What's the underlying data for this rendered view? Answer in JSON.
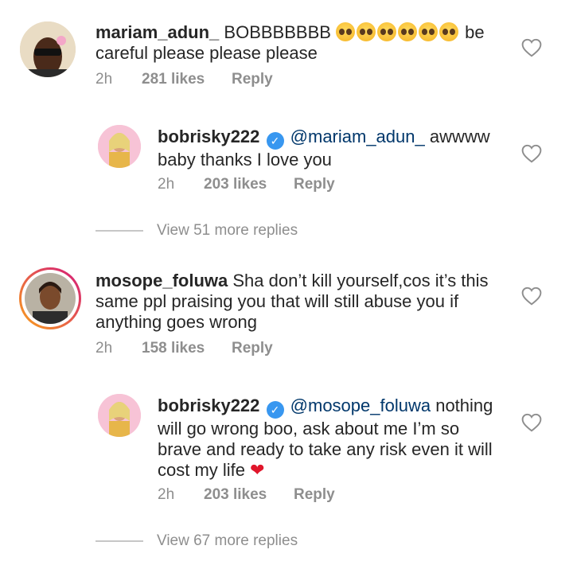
{
  "comments": [
    {
      "username": "mariam_adun_",
      "text_line1_after_user": " BOBBBBBBB ",
      "emoji_count": 6,
      "emoji_name": "pleading-face",
      "text_line1_tail": " be",
      "text_line2": "careful please please please",
      "time": "2h",
      "likes": "281 likes",
      "reply": "Reply"
    },
    {
      "username": "bobrisky222",
      "mention": "@mariam_adun_",
      "text_line1_tail": " awwww",
      "text_line2": "baby thanks I love you",
      "time": "2h",
      "likes": "203 likes",
      "reply": "Reply"
    },
    {
      "view_replies": "View 51 more replies"
    },
    {
      "username": "mosope_foluwa",
      "text_line1_tail": " Sha don’t kill yourself,cos it’s this",
      "text_line2": "same ppl praising you that will still abuse you if",
      "text_line3": "anything goes wrong",
      "time": "2h",
      "likes": "158 likes",
      "reply": "Reply"
    },
    {
      "username": "bobrisky222",
      "mention": "@mosope_foluwa",
      "text_line1_tail": " nothing",
      "text_line2": "will go wrong boo, ask about me I’m so",
      "text_line3": "brave and ready to take any risk even it will",
      "text_line4": "cost my life ",
      "time": "2h",
      "likes": "203 likes",
      "reply": "Reply"
    },
    {
      "view_replies": "View 67 more replies"
    }
  ],
  "icons": {
    "heart": "heart-outline-icon",
    "verified": "verified-badge-icon",
    "red_heart": "red-heart-emoji"
  },
  "colors": {
    "text": "#262626",
    "secondary": "#8e8e8e",
    "mention": "#00376b",
    "verified": "#3897f0",
    "story_ring_start": "#f9a21a",
    "story_ring_end": "#d3177c"
  }
}
